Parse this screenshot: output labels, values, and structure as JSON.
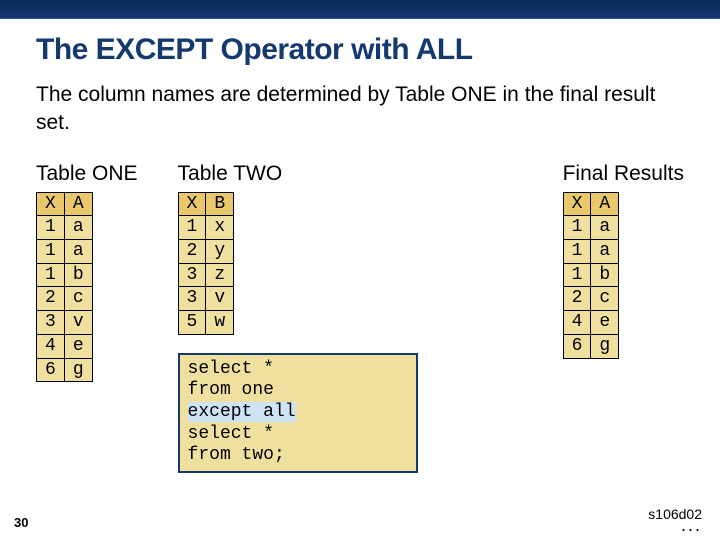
{
  "slide": {
    "title": "The EXCEPT Operator with ALL",
    "subtitle": "The column names are determined by Table ONE in the final result set.",
    "page_number": "30",
    "ref_code": "s106d02",
    "dots": "..."
  },
  "tables": {
    "one": {
      "title": "Table ONE",
      "headers": [
        "X",
        "A"
      ],
      "rows": [
        [
          "1",
          "a"
        ],
        [
          "1",
          "a"
        ],
        [
          "1",
          "b"
        ],
        [
          "2",
          "c"
        ],
        [
          "3",
          "v"
        ],
        [
          "4",
          "e"
        ],
        [
          "6",
          "g"
        ]
      ]
    },
    "two": {
      "title": "Table TWO",
      "headers": [
        "X",
        "B"
      ],
      "rows": [
        [
          "1",
          "x"
        ],
        [
          "2",
          "y"
        ],
        [
          "3",
          "z"
        ],
        [
          "3",
          "v"
        ],
        [
          "5",
          "w"
        ]
      ]
    },
    "final": {
      "title": "Final Results",
      "headers": [
        "X",
        "A"
      ],
      "rows": [
        [
          "1",
          "a"
        ],
        [
          "1",
          "a"
        ],
        [
          "1",
          "b"
        ],
        [
          "2",
          "c"
        ],
        [
          "4",
          "e"
        ],
        [
          "6",
          "g"
        ]
      ]
    }
  },
  "code": {
    "line1": "select *",
    "line2": "   from one",
    "line3": "except all",
    "line4": "select *",
    "line5": "   from two;"
  }
}
